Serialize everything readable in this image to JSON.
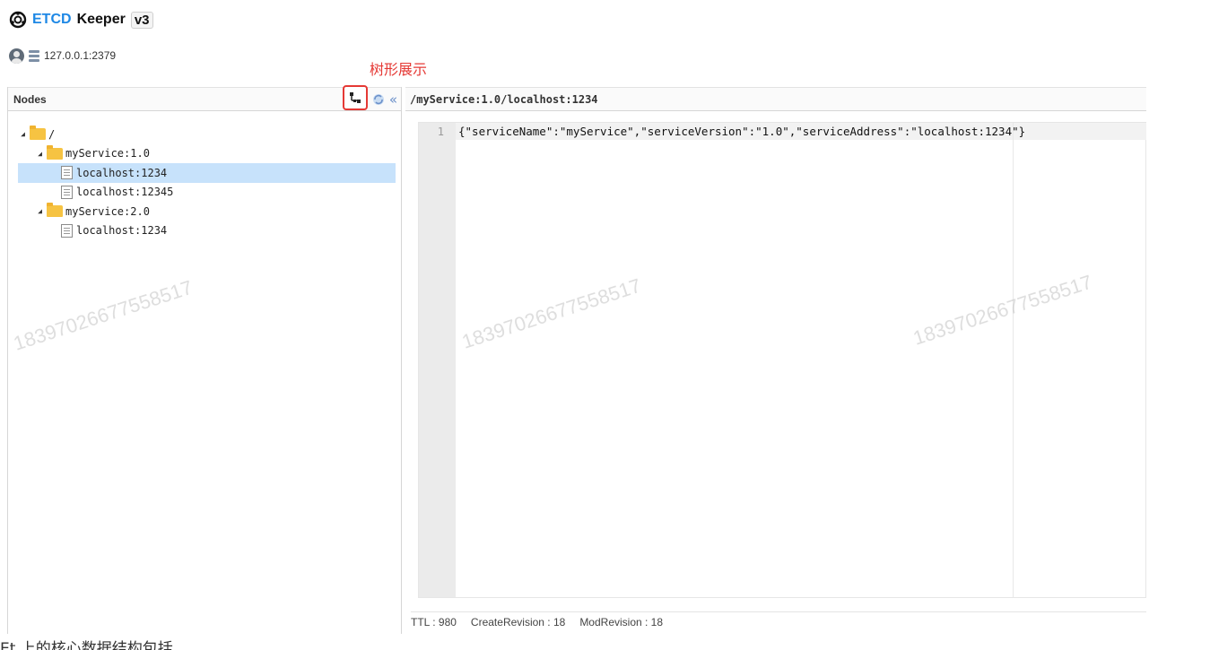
{
  "header": {
    "brand_accent": "ETCD",
    "brand_text": "Keeper",
    "version": "v3"
  },
  "server": {
    "address": "127.0.0.1:2379"
  },
  "annotation": {
    "label": "树形展示",
    "color": "#e53935"
  },
  "nodes_panel": {
    "title": "Nodes",
    "collapse_glyph": "«",
    "tree": [
      {
        "label": "/",
        "type": "folder",
        "depth": 0,
        "expanded": true
      },
      {
        "label": "myService:1.0",
        "type": "folder",
        "depth": 1,
        "expanded": true
      },
      {
        "label": "localhost:1234",
        "type": "file",
        "depth": 2,
        "selected": true
      },
      {
        "label": "localhost:12345",
        "type": "file",
        "depth": 2
      },
      {
        "label": "myService:2.0",
        "type": "folder",
        "depth": 1,
        "expanded": true
      },
      {
        "label": "localhost:1234",
        "type": "file",
        "depth": 2
      }
    ]
  },
  "editor": {
    "path": "/myService:1.0/localhost:1234",
    "line_number": "1",
    "content": "{\"serviceName\":\"myService\",\"serviceVersion\":\"1.0\",\"serviceAddress\":\"localhost:1234\"}"
  },
  "meta": {
    "ttl": "TTL : 980",
    "create_revision": "CreateRevision : 18",
    "mod_revision": "ModRevision : 18"
  },
  "footer": {
    "text": "Et 上的核心数据结构包括"
  },
  "watermark": {
    "text": "18397026677558517"
  },
  "colors": {
    "accent": "#1e88e5",
    "selection": "#c7e2fb",
    "folder": "#f6c342"
  }
}
